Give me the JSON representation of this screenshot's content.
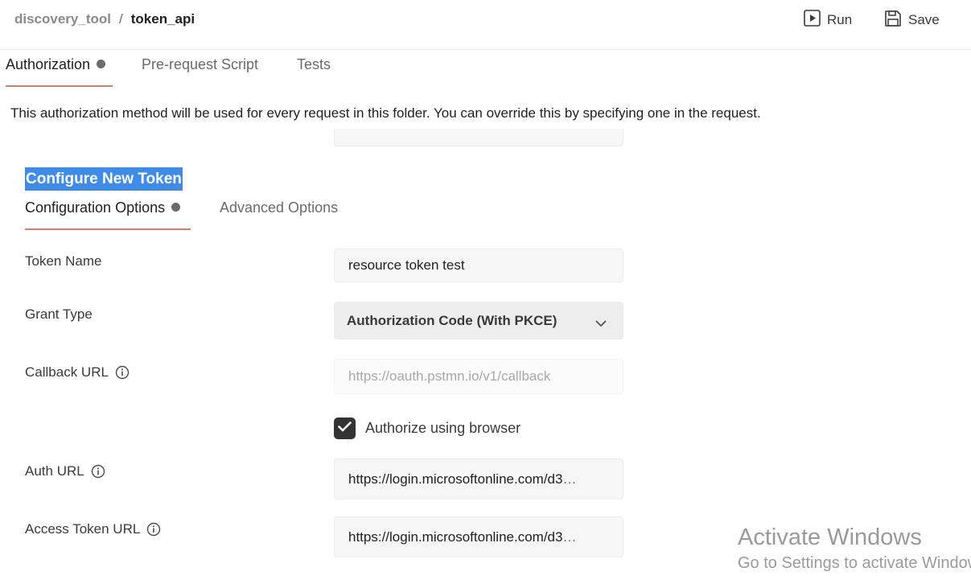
{
  "breadcrumb": {
    "parent": "discovery_tool",
    "separator": "/",
    "current": "token_api"
  },
  "header": {
    "run": {
      "label": "Run",
      "icon": "play-icon"
    },
    "save": {
      "label": "Save",
      "icon": "save-icon"
    }
  },
  "tabs": [
    {
      "label": "Authorization",
      "active": true,
      "dot": true
    },
    {
      "label": "Pre-request Script",
      "active": false
    },
    {
      "label": "Tests",
      "active": false
    }
  ],
  "description": "This authorization method will be used for every request in this folder. You can override this by specifying one in the request.",
  "section_title": "Configure New Token",
  "sub_tabs": [
    {
      "label": "Configuration Options",
      "active": true,
      "dot": true
    },
    {
      "label": "Advanced Options",
      "active": false
    }
  ],
  "form": {
    "token_name": {
      "label": "Token Name",
      "value": "resource token test"
    },
    "grant_type": {
      "label": "Grant Type",
      "value": "Authorization Code (With PKCE)",
      "icon": "chevron-down-icon"
    },
    "callback_url": {
      "label": "Callback URL",
      "placeholder": "https://oauth.pstmn.io/v1/callback",
      "icon": "info-icon"
    },
    "authorize_browser": {
      "label": "Authorize using browser",
      "checked": true
    },
    "auth_url": {
      "label": "Auth URL",
      "value": "https://login.microsoftonline.com/d3",
      "icon": "info-icon"
    },
    "access_token_url": {
      "label": "Access Token URL",
      "value": "https://login.microsoftonline.com/d3",
      "icon": "info-icon"
    }
  },
  "watermark": {
    "title": "Activate Windows",
    "subtitle": "Go to Settings to activate Windows."
  },
  "colors": {
    "accent_underline": "#c8836f",
    "selection_highlight": "#3e8ce6",
    "checkbox": "#333333"
  }
}
